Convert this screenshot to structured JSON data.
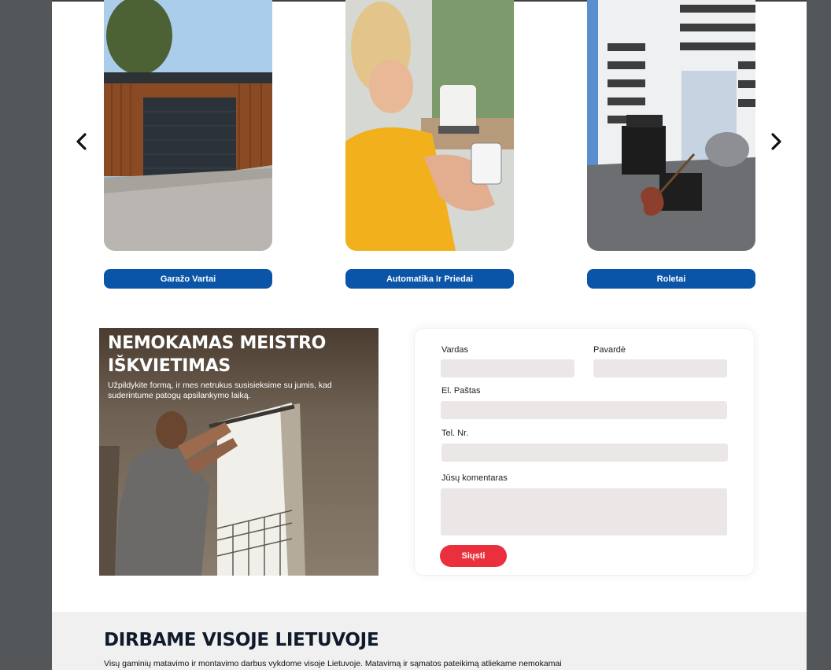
{
  "carousel": {
    "prev_icon": "chevron-left-icon",
    "next_icon": "chevron-right-icon",
    "cards": [
      {
        "label": "Garažo Vartai"
      },
      {
        "label": "Automatika Ir Priedai"
      },
      {
        "label": "Roletai"
      }
    ]
  },
  "promo": {
    "title": "NEMOKAMAS MEISTRO IŠKVIETIMAS",
    "description": "Užpildykite formą, ir mes netrukus susisieksime su jumis, kad suderintume patogų apsilankymo laiką."
  },
  "form": {
    "first_name_label": "Vardas",
    "last_name_label": "Pavardė",
    "email_label": "El. Paštas",
    "phone_label": "Tel. Nr.",
    "comment_label": "Jūsų komentaras",
    "submit_label": "Siųsti"
  },
  "section": {
    "title": "DIRBAME VISOJE LIETUVOJE",
    "text": "Visų gaminių matavimo ir montavimo darbus vykdome visoje Lietuvoje. Matavimą ir sąmatos pateikimą atliekame nemokamai"
  },
  "colors": {
    "button_blue": "#0a55a8",
    "submit_red": "#e9303c",
    "input_bg": "#ebe7e6",
    "backdrop": "#53575a"
  }
}
